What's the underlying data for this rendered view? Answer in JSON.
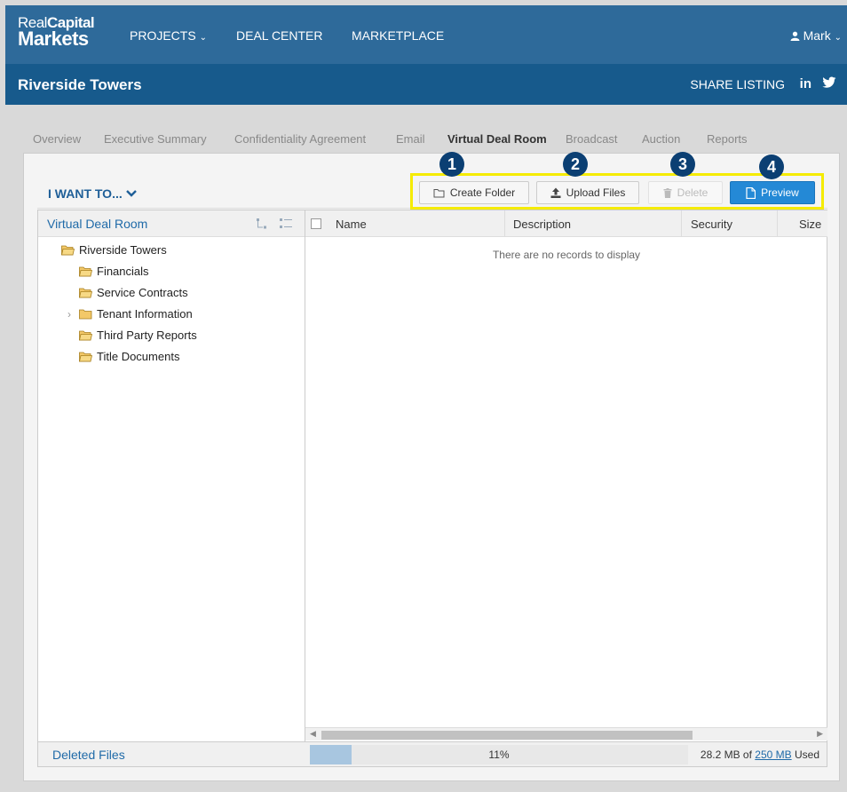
{
  "brand": {
    "line1_light": "Real",
    "line1_bold": "Capital",
    "line2": "Markets"
  },
  "nav": {
    "projects": "PROJECTS",
    "deal_center": "DEAL CENTER",
    "marketplace": "MARKETPLACE",
    "user": "Mark"
  },
  "title_bar": {
    "title": "Riverside Towers",
    "share": "SHARE LISTING",
    "linkedin": "in"
  },
  "tabs": [
    "Overview",
    "Executive Summary",
    "Confidentiality Agreement",
    "Email",
    "Virtual Deal Room",
    "Broadcast",
    "Auction",
    "Reports"
  ],
  "toolbar": {
    "i_want_to": "I WANT TO...",
    "create_folder": "Create Folder",
    "upload_files": "Upload Files",
    "delete": "Delete",
    "preview": "Preview",
    "badges": [
      "1",
      "2",
      "3",
      "4"
    ]
  },
  "tree": {
    "title": "Virtual Deal Room",
    "root": "Riverside Towers",
    "children": [
      "Financials",
      "Service Contracts",
      "Tenant Information",
      "Third Party Reports",
      "Title Documents"
    ]
  },
  "grid": {
    "columns": [
      "Name",
      "Description",
      "Security",
      "Size"
    ],
    "empty_message": "There are no records to display"
  },
  "footer": {
    "deleted_files": "Deleted Files",
    "progress_percent": 11,
    "progress_label": "11%",
    "used_prefix": "28.2 MB of",
    "quota": "250 MB",
    "used_suffix": "Used"
  },
  "colors": {
    "nav": "#2e6a9a",
    "title_bar": "#175a8c",
    "primary": "#2489d6",
    "badge": "#0b3f73",
    "highlight": "#f5eb00"
  }
}
